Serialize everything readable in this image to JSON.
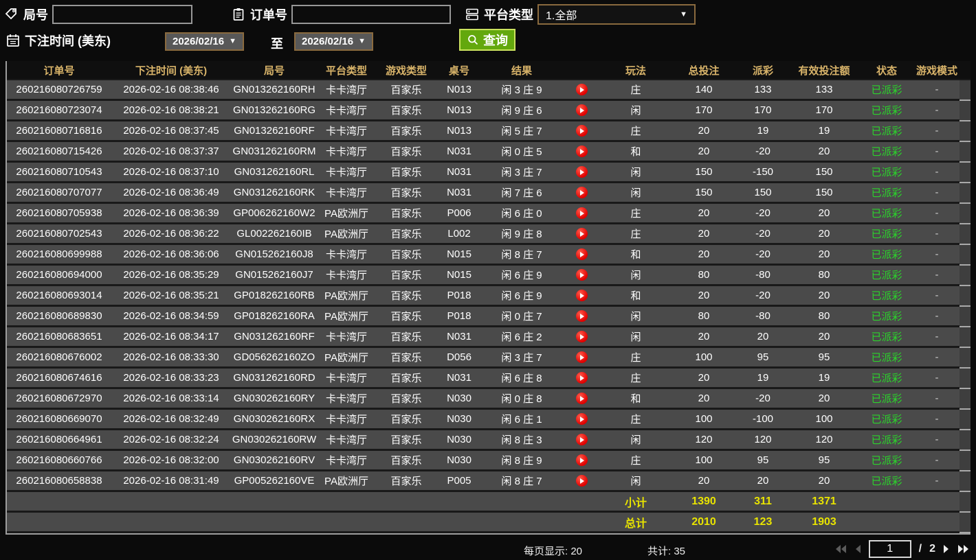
{
  "filters": {
    "game_no_label": "局号",
    "order_no_label": "订单号",
    "platform_label": "平台类型",
    "platform_value": "1.全部",
    "bet_time_label": "下注时间 (美东)",
    "date_from": "2026/02/16",
    "date_to": "2026/02/16",
    "to_label": "至",
    "query_label": "查询"
  },
  "colors": {
    "header_gold": "#d9b46a",
    "status_green": "#2bd42b",
    "payout_positive_red": "#b01e2e",
    "payout_negative_green": "#8fce00",
    "summary_yellow": "#e9e400",
    "query_button_green": "#63a80d"
  },
  "table": {
    "headers": [
      "订单号",
      "下注时间 (美东)",
      "局号",
      "平台类型",
      "游戏类型",
      "桌号",
      "结果",
      "玩法",
      "总投注",
      "派彩",
      "有效投注额",
      "状态",
      "游戏模式"
    ],
    "rows": [
      {
        "order": "260216080726759",
        "time": "2026-02-16 08:38:46",
        "game_no": "GN013262160RH",
        "platform": "卡卡湾厅",
        "game_type": "百家乐",
        "table_no": "N013",
        "result": "闲 3 庄 9",
        "play_type": "庄",
        "total_bet": "140",
        "payout": "133",
        "valid_bet": "133",
        "status": "已派彩",
        "mode": "-"
      },
      {
        "order": "260216080723074",
        "time": "2026-02-16 08:38:21",
        "game_no": "GN013262160RG",
        "platform": "卡卡湾厅",
        "game_type": "百家乐",
        "table_no": "N013",
        "result": "闲 9 庄 6",
        "play_type": "闲",
        "total_bet": "170",
        "payout": "170",
        "valid_bet": "170",
        "status": "已派彩",
        "mode": "-"
      },
      {
        "order": "260216080716816",
        "time": "2026-02-16 08:37:45",
        "game_no": "GN013262160RF",
        "platform": "卡卡湾厅",
        "game_type": "百家乐",
        "table_no": "N013",
        "result": "闲 5 庄 7",
        "play_type": "庄",
        "total_bet": "20",
        "payout": "19",
        "valid_bet": "19",
        "status": "已派彩",
        "mode": "-"
      },
      {
        "order": "260216080715426",
        "time": "2026-02-16 08:37:37",
        "game_no": "GN031262160RM",
        "platform": "卡卡湾厅",
        "game_type": "百家乐",
        "table_no": "N031",
        "result": "闲 0 庄 5",
        "play_type": "和",
        "total_bet": "20",
        "payout": "-20",
        "valid_bet": "20",
        "status": "已派彩",
        "mode": "-"
      },
      {
        "order": "260216080710543",
        "time": "2026-02-16 08:37:10",
        "game_no": "GN031262160RL",
        "platform": "卡卡湾厅",
        "game_type": "百家乐",
        "table_no": "N031",
        "result": "闲 3 庄 7",
        "play_type": "闲",
        "total_bet": "150",
        "payout": "-150",
        "valid_bet": "150",
        "status": "已派彩",
        "mode": "-"
      },
      {
        "order": "260216080707077",
        "time": "2026-02-16 08:36:49",
        "game_no": "GN031262160RK",
        "platform": "卡卡湾厅",
        "game_type": "百家乐",
        "table_no": "N031",
        "result": "闲 7 庄 6",
        "play_type": "闲",
        "total_bet": "150",
        "payout": "150",
        "valid_bet": "150",
        "status": "已派彩",
        "mode": "-"
      },
      {
        "order": "260216080705938",
        "time": "2026-02-16 08:36:39",
        "game_no": "GP006262160W2",
        "platform": "PA欧洲厅",
        "game_type": "百家乐",
        "table_no": "P006",
        "result": "闲 6 庄 0",
        "play_type": "庄",
        "total_bet": "20",
        "payout": "-20",
        "valid_bet": "20",
        "status": "已派彩",
        "mode": "-"
      },
      {
        "order": "260216080702543",
        "time": "2026-02-16 08:36:22",
        "game_no": "GL002262160IB",
        "platform": "PA欧洲厅",
        "game_type": "百家乐",
        "table_no": "L002",
        "result": "闲 9 庄 8",
        "play_type": "庄",
        "total_bet": "20",
        "payout": "-20",
        "valid_bet": "20",
        "status": "已派彩",
        "mode": "-"
      },
      {
        "order": "260216080699988",
        "time": "2026-02-16 08:36:06",
        "game_no": "GN015262160J8",
        "platform": "卡卡湾厅",
        "game_type": "百家乐",
        "table_no": "N015",
        "result": "闲 8 庄 7",
        "play_type": "和",
        "total_bet": "20",
        "payout": "-20",
        "valid_bet": "20",
        "status": "已派彩",
        "mode": "-"
      },
      {
        "order": "260216080694000",
        "time": "2026-02-16 08:35:29",
        "game_no": "GN015262160J7",
        "platform": "卡卡湾厅",
        "game_type": "百家乐",
        "table_no": "N015",
        "result": "闲 6 庄 9",
        "play_type": "闲",
        "total_bet": "80",
        "payout": "-80",
        "valid_bet": "80",
        "status": "已派彩",
        "mode": "-"
      },
      {
        "order": "260216080693014",
        "time": "2026-02-16 08:35:21",
        "game_no": "GP018262160RB",
        "platform": "PA欧洲厅",
        "game_type": "百家乐",
        "table_no": "P018",
        "result": "闲 6 庄 9",
        "play_type": "和",
        "total_bet": "20",
        "payout": "-20",
        "valid_bet": "20",
        "status": "已派彩",
        "mode": "-"
      },
      {
        "order": "260216080689830",
        "time": "2026-02-16 08:34:59",
        "game_no": "GP018262160RA",
        "platform": "PA欧洲厅",
        "game_type": "百家乐",
        "table_no": "P018",
        "result": "闲 0 庄 7",
        "play_type": "闲",
        "total_bet": "80",
        "payout": "-80",
        "valid_bet": "80",
        "status": "已派彩",
        "mode": "-"
      },
      {
        "order": "260216080683651",
        "time": "2026-02-16 08:34:17",
        "game_no": "GN031262160RF",
        "platform": "卡卡湾厅",
        "game_type": "百家乐",
        "table_no": "N031",
        "result": "闲 6 庄 2",
        "play_type": "闲",
        "total_bet": "20",
        "payout": "20",
        "valid_bet": "20",
        "status": "已派彩",
        "mode": "-"
      },
      {
        "order": "260216080676002",
        "time": "2026-02-16 08:33:30",
        "game_no": "GD056262160ZO",
        "platform": "PA欧洲厅",
        "game_type": "百家乐",
        "table_no": "D056",
        "result": "闲 3 庄 7",
        "play_type": "庄",
        "total_bet": "100",
        "payout": "95",
        "valid_bet": "95",
        "status": "已派彩",
        "mode": "-"
      },
      {
        "order": "260216080674616",
        "time": "2026-02-16 08:33:23",
        "game_no": "GN031262160RD",
        "platform": "卡卡湾厅",
        "game_type": "百家乐",
        "table_no": "N031",
        "result": "闲 6 庄 8",
        "play_type": "庄",
        "total_bet": "20",
        "payout": "19",
        "valid_bet": "19",
        "status": "已派彩",
        "mode": "-"
      },
      {
        "order": "260216080672970",
        "time": "2026-02-16 08:33:14",
        "game_no": "GN030262160RY",
        "platform": "卡卡湾厅",
        "game_type": "百家乐",
        "table_no": "N030",
        "result": "闲 0 庄 8",
        "play_type": "和",
        "total_bet": "20",
        "payout": "-20",
        "valid_bet": "20",
        "status": "已派彩",
        "mode": "-"
      },
      {
        "order": "260216080669070",
        "time": "2026-02-16 08:32:49",
        "game_no": "GN030262160RX",
        "platform": "卡卡湾厅",
        "game_type": "百家乐",
        "table_no": "N030",
        "result": "闲 6 庄 1",
        "play_type": "庄",
        "total_bet": "100",
        "payout": "-100",
        "valid_bet": "100",
        "status": "已派彩",
        "mode": "-"
      },
      {
        "order": "260216080664961",
        "time": "2026-02-16 08:32:24",
        "game_no": "GN030262160RW",
        "platform": "卡卡湾厅",
        "game_type": "百家乐",
        "table_no": "N030",
        "result": "闲 8 庄 3",
        "play_type": "闲",
        "total_bet": "120",
        "payout": "120",
        "valid_bet": "120",
        "status": "已派彩",
        "mode": "-"
      },
      {
        "order": "260216080660766",
        "time": "2026-02-16 08:32:00",
        "game_no": "GN030262160RV",
        "platform": "卡卡湾厅",
        "game_type": "百家乐",
        "table_no": "N030",
        "result": "闲 8 庄 9",
        "play_type": "庄",
        "total_bet": "100",
        "payout": "95",
        "valid_bet": "95",
        "status": "已派彩",
        "mode": "-"
      },
      {
        "order": "260216080658838",
        "time": "2026-02-16 08:31:49",
        "game_no": "GP005262160VE",
        "platform": "PA欧洲厅",
        "game_type": "百家乐",
        "table_no": "P005",
        "result": "闲 8 庄 7",
        "play_type": "闲",
        "total_bet": "20",
        "payout": "20",
        "valid_bet": "20",
        "status": "已派彩",
        "mode": "-"
      }
    ],
    "subtotal": {
      "label": "小计",
      "total_bet": "1390",
      "payout": "311",
      "valid_bet": "1371"
    },
    "total": {
      "label": "总计",
      "total_bet": "2010",
      "payout": "123",
      "valid_bet": "1903"
    }
  },
  "footer": {
    "per_page_label": "每页显示:",
    "per_page_value": "20",
    "total_count_label": "共计:",
    "total_count_value": "35",
    "page": "1",
    "page_sep": "/",
    "total_pages": "2"
  }
}
